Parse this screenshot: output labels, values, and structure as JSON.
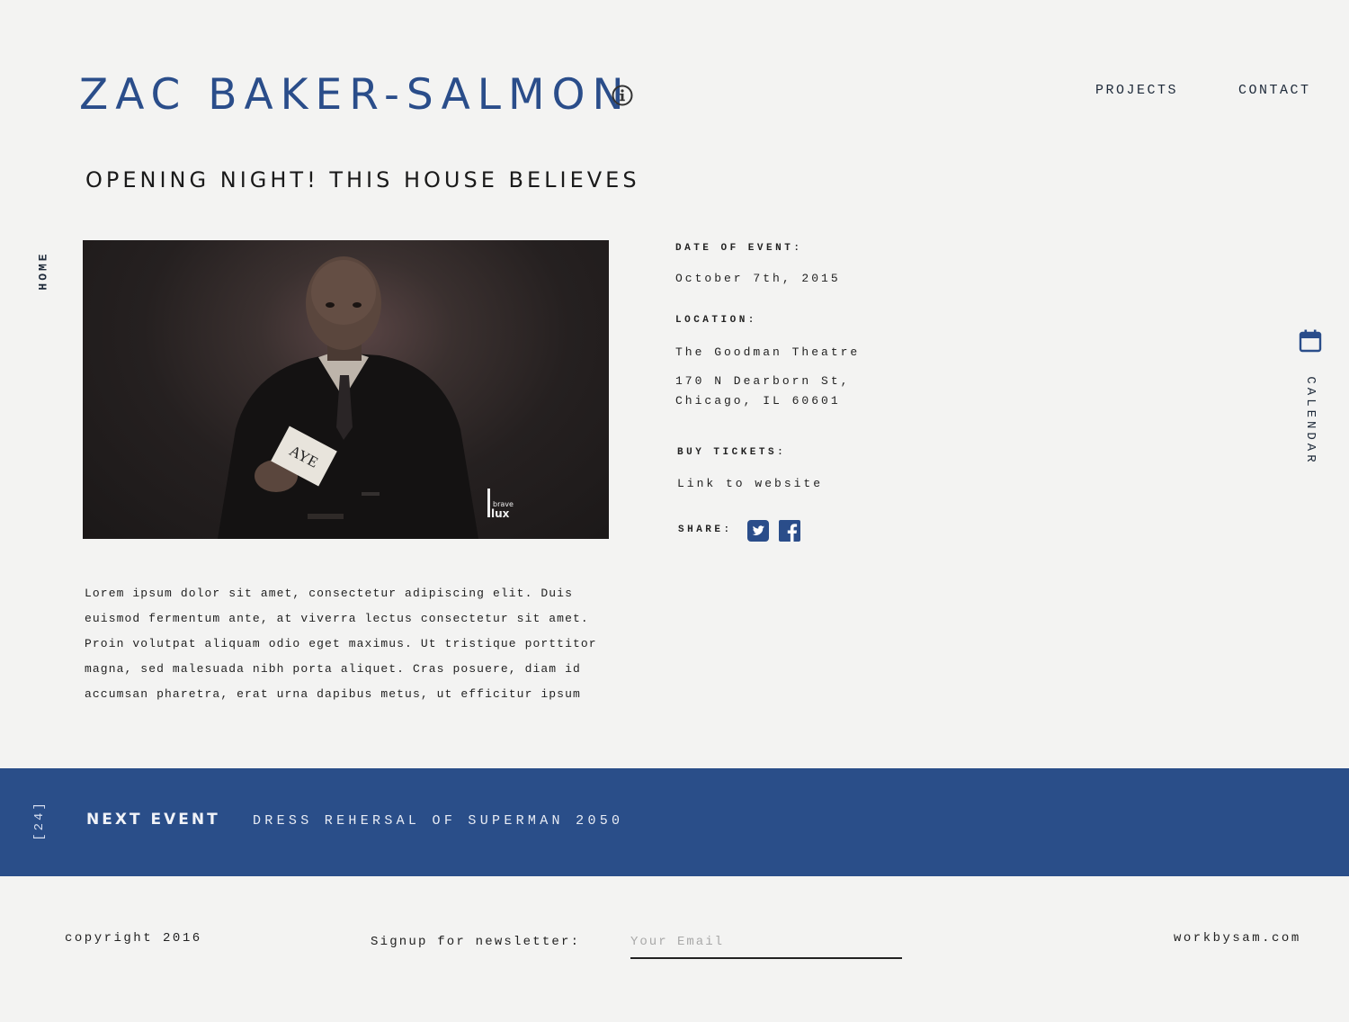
{
  "header": {
    "title": "ZAC BAKER-SALMON",
    "nav": {
      "projects": "PROJECTS",
      "contact": "CONTACT"
    }
  },
  "side_nav": {
    "home": "HOME",
    "calendar": "CALENDAR"
  },
  "event": {
    "title": "OPENING NIGHT! THIS HOUSE BELIEVES",
    "photo": {
      "card_text": "AYE",
      "watermark_small": "brave",
      "watermark_large": "lux"
    },
    "date_label": "DATE OF EVENT:",
    "date_value": "October 7th, 2015",
    "location_label": "LOCATION:",
    "location_name": "The Goodman Theatre",
    "address_line1": "170 N Dearborn St,",
    "address_line2": "Chicago, IL 60601",
    "tickets_label": "BUY TICKETS:",
    "tickets_link": "Link to website",
    "share_label": "SHARE:",
    "description_lines": [
      "Lorem ipsum dolor sit amet, consectetur adipiscing elit. Duis",
      "euismod fermentum ante, at viverra lectus consectetur sit amet.",
      "Proin volutpat aliquam odio eget maximus. Ut tristique porttitor",
      "magna, sed malesuada nibh porta aliquet. Cras posuere, diam id",
      "accumsan pharetra, erat urna dapibus metus, ut efficitur ipsum"
    ]
  },
  "next_event": {
    "count": "[24]",
    "label": "NEXT EVENT",
    "name": "DRESS REHERSAL OF SUPERMAN 2050"
  },
  "footer": {
    "copyright": "copyright 2016",
    "newsletter_label": "Signup for newsletter:",
    "email_placeholder": "Your Email",
    "site": "workbysam.com"
  },
  "icons": {
    "info": "info-icon",
    "calendar": "calendar-icon",
    "twitter": "twitter-icon",
    "facebook": "facebook-icon"
  },
  "colors": {
    "accent": "#2a4d8a",
    "band": "#2a4e89",
    "background": "#f3f3f2",
    "text": "#222222"
  }
}
